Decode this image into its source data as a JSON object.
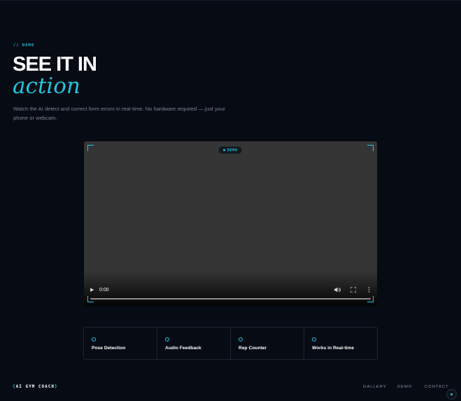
{
  "hero": {
    "eyebrow": "// DEMO",
    "title_line1": "SEE IT IN",
    "title_line2": "action",
    "description": "Watch the AI detect and correct form errors in real-time. No hardware required — just your phone or webcam."
  },
  "video": {
    "badge": "DEMO",
    "current_time": "0:00",
    "progress": 0
  },
  "features": [
    {
      "label": "Pose Detection"
    },
    {
      "label": "Audio Feedback"
    },
    {
      "label": "Rep Counter"
    },
    {
      "label": "Works in Real-time"
    }
  ],
  "footer": {
    "brand_open": "{",
    "brand": "AI GYM COACH",
    "brand_close": "}",
    "nav": [
      "GALLERY",
      "DEMO",
      "CONTACT"
    ]
  },
  "colors": {
    "accent": "#22c6e0",
    "background": "#070b13"
  },
  "icons": {
    "play": "play-icon",
    "volume": "volume-icon",
    "fullscreen": "fullscreen-icon",
    "more": "more-options-icon",
    "feature": "circle-outline-icon"
  }
}
